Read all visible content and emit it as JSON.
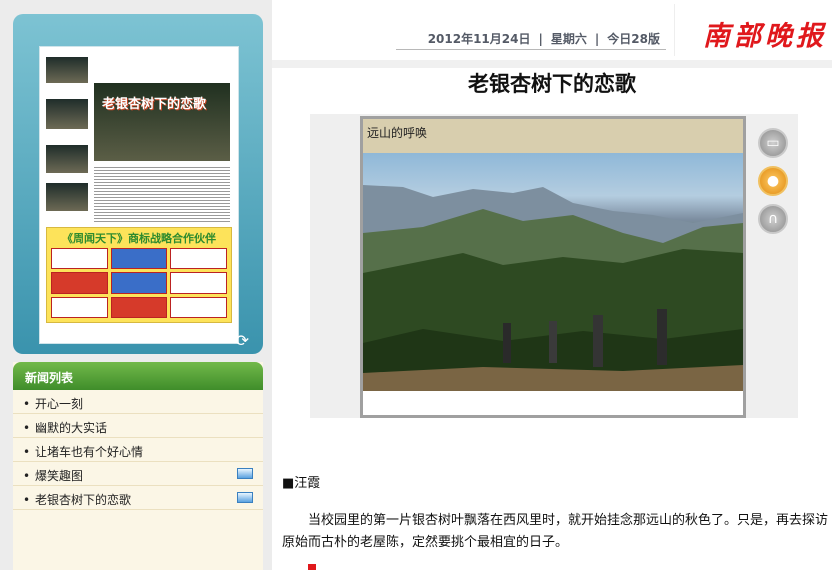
{
  "left": {
    "page_thumb": {
      "headline": "老银杏树下的恋歌",
      "ad_title": "《周闻天下》商标战略合作伙伴"
    },
    "news_list": {
      "header": "新闻列表",
      "items": [
        {
          "label": "开心一刻",
          "has_media": false
        },
        {
          "label": "幽默的大实话",
          "has_media": false
        },
        {
          "label": "让堵车也有个好心情",
          "has_media": false
        },
        {
          "label": "爆笑趣图",
          "has_media": true
        },
        {
          "label": "老银杏树下的恋歌",
          "has_media": true
        }
      ]
    }
  },
  "header": {
    "date": "2012年11月24日",
    "weekday": "星期六",
    "edition": "今日28版",
    "separator": "|",
    "logo": "南部晚报"
  },
  "article": {
    "title": "老银杏树下的恋歌",
    "photo_caption": "远山的呼唤",
    "author": "■汪霞",
    "body": "当校园里的第一片银杏树叶飘落在西风里时，就开始挂念那远山的秋色了。只是，再去探访原始而古朴的老屋陈，定然要挑个最相宜的日子。"
  },
  "icons": {
    "refresh": "refresh-icon",
    "camera": "camera-icon",
    "person": "person-icon",
    "headphones": "headphones-icon",
    "media": "video-icon"
  },
  "colors": {
    "brand_red": "#e0181c",
    "panel_teal": "#3a93ad",
    "list_green": "#3f8d2a"
  }
}
